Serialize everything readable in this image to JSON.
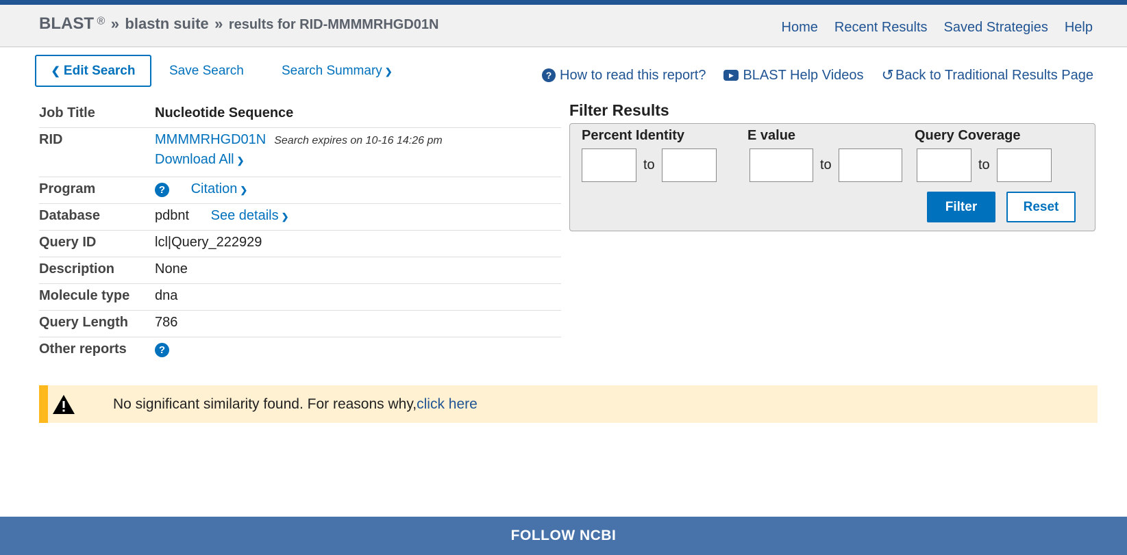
{
  "header": {
    "brand": "BLAST",
    "reg": "®",
    "sep": "»",
    "suite": "blastn suite",
    "results": "results for RID-MMMMRHGD01N",
    "nav": [
      "Home",
      "Recent Results",
      "Saved Strategies",
      "Help"
    ]
  },
  "actions": {
    "edit": "Edit Search",
    "save": "Save Search",
    "summary": "Search Summary",
    "how_to": "How to read this report?",
    "videos": "BLAST Help Videos",
    "back": "Back to Traditional Results Page"
  },
  "info": {
    "job_title_label": "Job Title",
    "job_title": "Nucleotide Sequence",
    "rid_label": "RID",
    "rid": "MMMMRHGD01N",
    "expires": "Search expires on 10-16 14:26 pm",
    "download": "Download All",
    "program_label": "Program",
    "citation": "Citation",
    "database_label": "Database",
    "database": "pdbnt",
    "see_details": "See details",
    "query_id_label": "Query ID",
    "query_id": "lcl|Query_222929",
    "description_label": "Description",
    "description": "None",
    "molecule_label": "Molecule type",
    "molecule": "dna",
    "length_label": "Query Length",
    "length": "786",
    "other_label": "Other reports"
  },
  "filter": {
    "title": "Filter Results",
    "percent_identity": "Percent Identity",
    "e_value": "E value",
    "query_coverage": "Query Coverage",
    "to": "to",
    "filter_btn": "Filter",
    "reset_btn": "Reset"
  },
  "alert": {
    "text": "No significant similarity found. For reasons why,",
    "link": "click here"
  },
  "footer": {
    "text": "FOLLOW NCBI"
  },
  "colors": {
    "accent": "#0071bc",
    "nav": "#205493",
    "alert_bg": "#fff1d2",
    "alert_border": "#fdb81e",
    "footer": "#4773aa"
  }
}
